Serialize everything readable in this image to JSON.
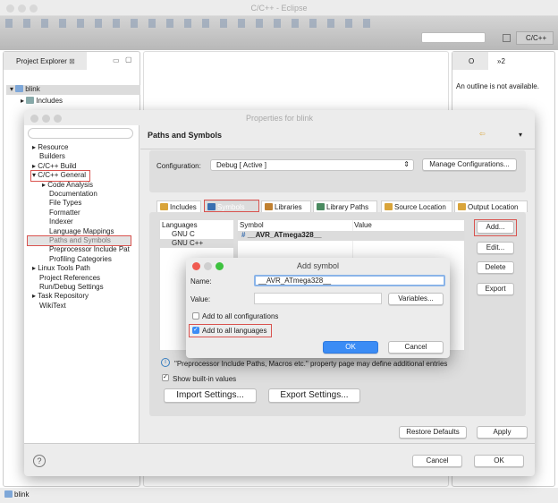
{
  "window": {
    "title": "C/C++ - Eclipse",
    "perspective": "C/C++"
  },
  "explorer": {
    "tab": "Project Explorer",
    "project": "blink",
    "child": "Includes"
  },
  "outline": {
    "tab": "O",
    "tab2": "»2",
    "message": "An outline is not available."
  },
  "status": {
    "item": "blink"
  },
  "properties": {
    "title": "Properties for blink",
    "tree": [
      "Resource",
      "Builders",
      "C/C++ Build",
      "C/C++ General",
      "Code Analysis",
      "Documentation",
      "File Types",
      "Formatter",
      "Indexer",
      "Language Mappings",
      "Paths and Symbols",
      "Preprocessor Include Pat",
      "Profiling Categories",
      "Linux Tools Path",
      "Project References",
      "Run/Debug Settings",
      "Task Repository",
      "WikiText"
    ],
    "page_title": "Paths and Symbols",
    "config_label": "Configuration:",
    "config_value": "Debug  [ Active ]",
    "manage": "Manage Configurations...",
    "tabs": [
      "Includes",
      "Symbols",
      "Libraries",
      "Library Paths",
      "Source Location",
      "Output Location"
    ],
    "languages_header": "Languages",
    "languages": [
      "GNU C",
      "GNU C++"
    ],
    "symbol_header": "Symbol",
    "value_header": "Value",
    "symbols": [
      "__AVR_ATmega328__"
    ],
    "side_buttons": [
      "Add...",
      "Edit...",
      "Delete",
      "Export"
    ],
    "info": "\"Preprocessor Include Paths, Macros etc.\" property page may define additional entries",
    "show_builtin": "Show built-in values",
    "import": "Import Settings...",
    "export": "Export Settings...",
    "restore": "Restore Defaults",
    "apply": "Apply",
    "cancel": "Cancel",
    "ok": "OK"
  },
  "add_symbol": {
    "title": "Add symbol",
    "name_label": "Name:",
    "name_value": "__AVR_ATmega328__",
    "value_label": "Value:",
    "value_value": "",
    "variables": "Variables...",
    "all_configs": "Add to all configurations",
    "all_configs_checked": false,
    "all_langs": "Add to all languages",
    "all_langs_checked": true,
    "ok": "OK",
    "cancel": "Cancel"
  },
  "colors": {
    "highlight": "#d9534f",
    "ok_blue": "#3b8cf5",
    "selection": "#dcdcdc"
  }
}
